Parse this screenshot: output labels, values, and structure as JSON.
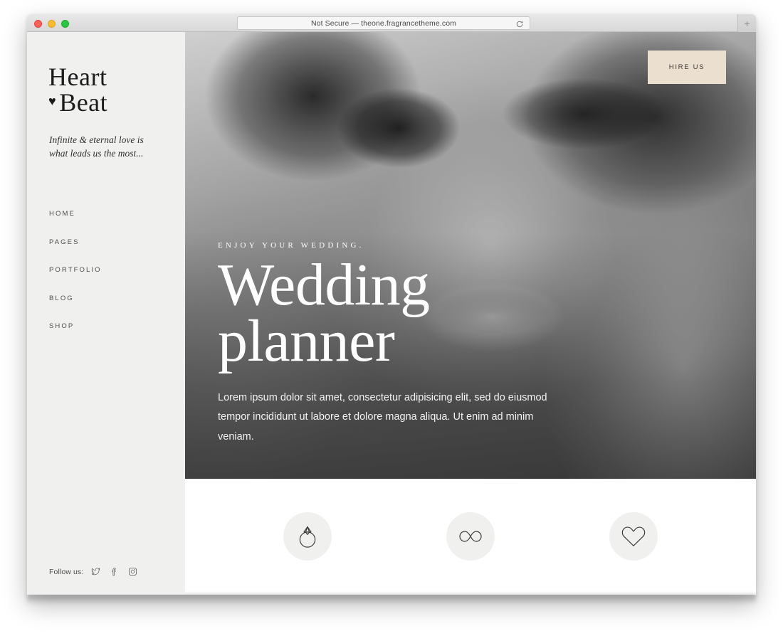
{
  "browser": {
    "url_text": "Not Secure — theone.fragrancetheme.com",
    "reload_icon": "reload-icon",
    "newtab_label": "+",
    "traffic_lights": [
      "close",
      "minimize",
      "maximize"
    ]
  },
  "sidebar": {
    "logo": {
      "line1": "Heart",
      "line2": "Beat",
      "heart_glyph": "♥"
    },
    "tagline": "Infinite & eternal love is what leads us the most...",
    "nav": [
      {
        "label": "HOME"
      },
      {
        "label": "PAGES"
      },
      {
        "label": "PORTFOLIO"
      },
      {
        "label": "BLOG"
      },
      {
        "label": "SHOP"
      }
    ],
    "follow": {
      "label": "Follow us:",
      "icons": [
        "twitter-icon",
        "facebook-icon",
        "instagram-icon"
      ]
    }
  },
  "hero": {
    "hire_button": "HIRE US",
    "eyebrow": "ENJOY YOUR WEDDING.",
    "title_line1": "Wedding",
    "title_line2": "planner",
    "description": "Lorem ipsum dolor sit amet, consectetur adipisicing elit, sed do eiusmod tempor incididunt ut labore et dolore magna aliqua. Ut enim ad minim veniam."
  },
  "features": [
    {
      "icon": "ring-icon"
    },
    {
      "icon": "infinity-icon"
    },
    {
      "icon": "heart-outline-icon"
    }
  ],
  "colors": {
    "accent_beige": "#ebdfd0",
    "sidebar_bg": "#f0f0ef",
    "text_dark": "#1c1c1c",
    "nav_text": "#4e4e4e"
  }
}
